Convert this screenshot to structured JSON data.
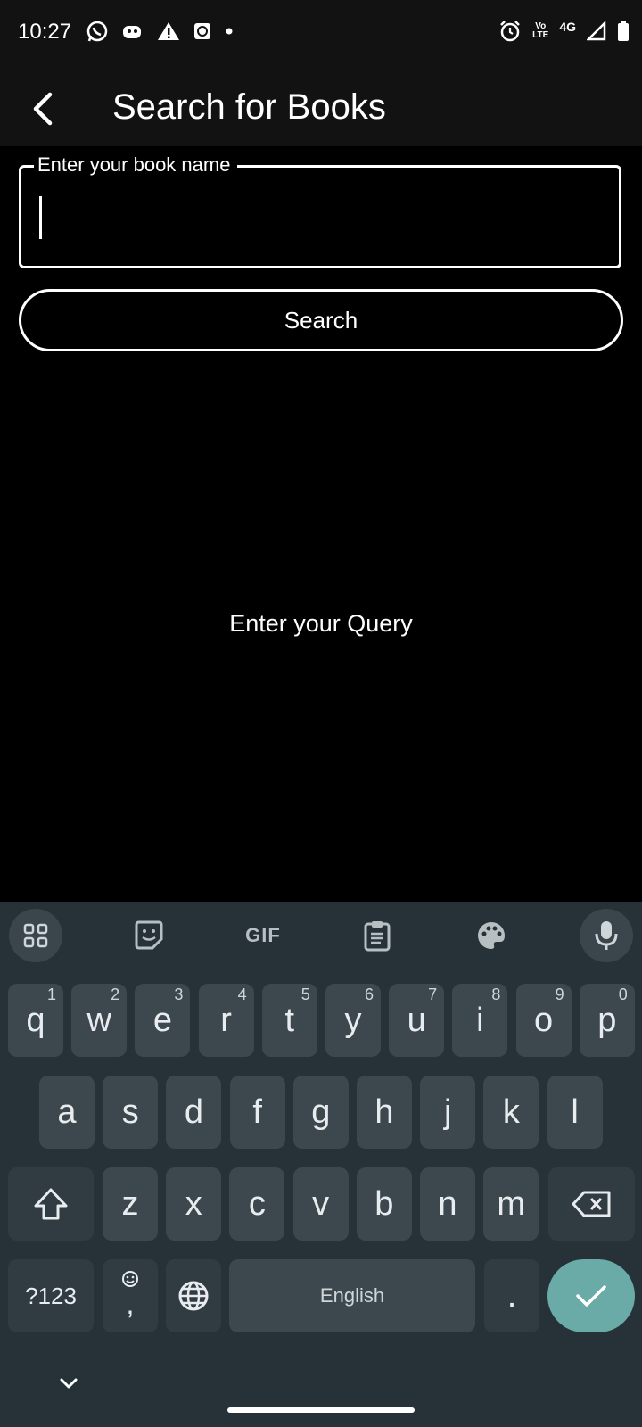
{
  "status": {
    "time": "10:27",
    "volte": "Vo LTE",
    "network": "4G"
  },
  "app_bar": {
    "title": "Search for Books",
    "back_icon": "arrow-back-icon"
  },
  "form": {
    "field_label": "Enter your book name",
    "field_value": "",
    "search_label": "Search"
  },
  "content": {
    "empty_message": "Enter your Query"
  },
  "keyboard": {
    "toolbar": [
      "apps-icon",
      "sticker-icon",
      "GIF",
      "clipboard-icon",
      "palette-icon",
      "mic-icon"
    ],
    "row1": [
      {
        "k": "q",
        "h": "1"
      },
      {
        "k": "w",
        "h": "2"
      },
      {
        "k": "e",
        "h": "3"
      },
      {
        "k": "r",
        "h": "4"
      },
      {
        "k": "t",
        "h": "5"
      },
      {
        "k": "y",
        "h": "6"
      },
      {
        "k": "u",
        "h": "7"
      },
      {
        "k": "i",
        "h": "8"
      },
      {
        "k": "o",
        "h": "9"
      },
      {
        "k": "p",
        "h": "0"
      }
    ],
    "row2": [
      "a",
      "s",
      "d",
      "f",
      "g",
      "h",
      "j",
      "k",
      "l"
    ],
    "row3": [
      "z",
      "x",
      "c",
      "v",
      "b",
      "n",
      "m"
    ],
    "symbols_label": "?123",
    "comma_label": ",",
    "space_label": "English",
    "period_label": ".",
    "accent_color": "#6aaba8"
  }
}
